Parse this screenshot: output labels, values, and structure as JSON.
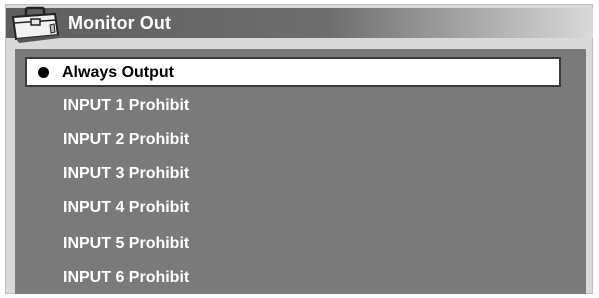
{
  "window": {
    "title": "Monitor Out"
  },
  "menu": {
    "items": [
      {
        "label": "Always Output",
        "selected": true
      },
      {
        "label": "INPUT 1 Prohibit",
        "selected": false
      },
      {
        "label": "INPUT 2 Prohibit",
        "selected": false
      },
      {
        "label": "INPUT 3 Prohibit",
        "selected": false
      },
      {
        "label": "INPUT 4 Prohibit",
        "selected": false
      },
      {
        "label": "INPUT 5 Prohibit",
        "selected": false
      },
      {
        "label": "INPUT 6 Prohibit",
        "selected": false
      }
    ]
  },
  "icons": {
    "title_icon": "toolbox-icon",
    "selection_marker": "bullet-icon"
  },
  "colors": {
    "panel": "#7a7a7a",
    "title_bar": "#5e5e5e",
    "selected_bg": "#ffffff",
    "item_text": "#ffffff"
  }
}
